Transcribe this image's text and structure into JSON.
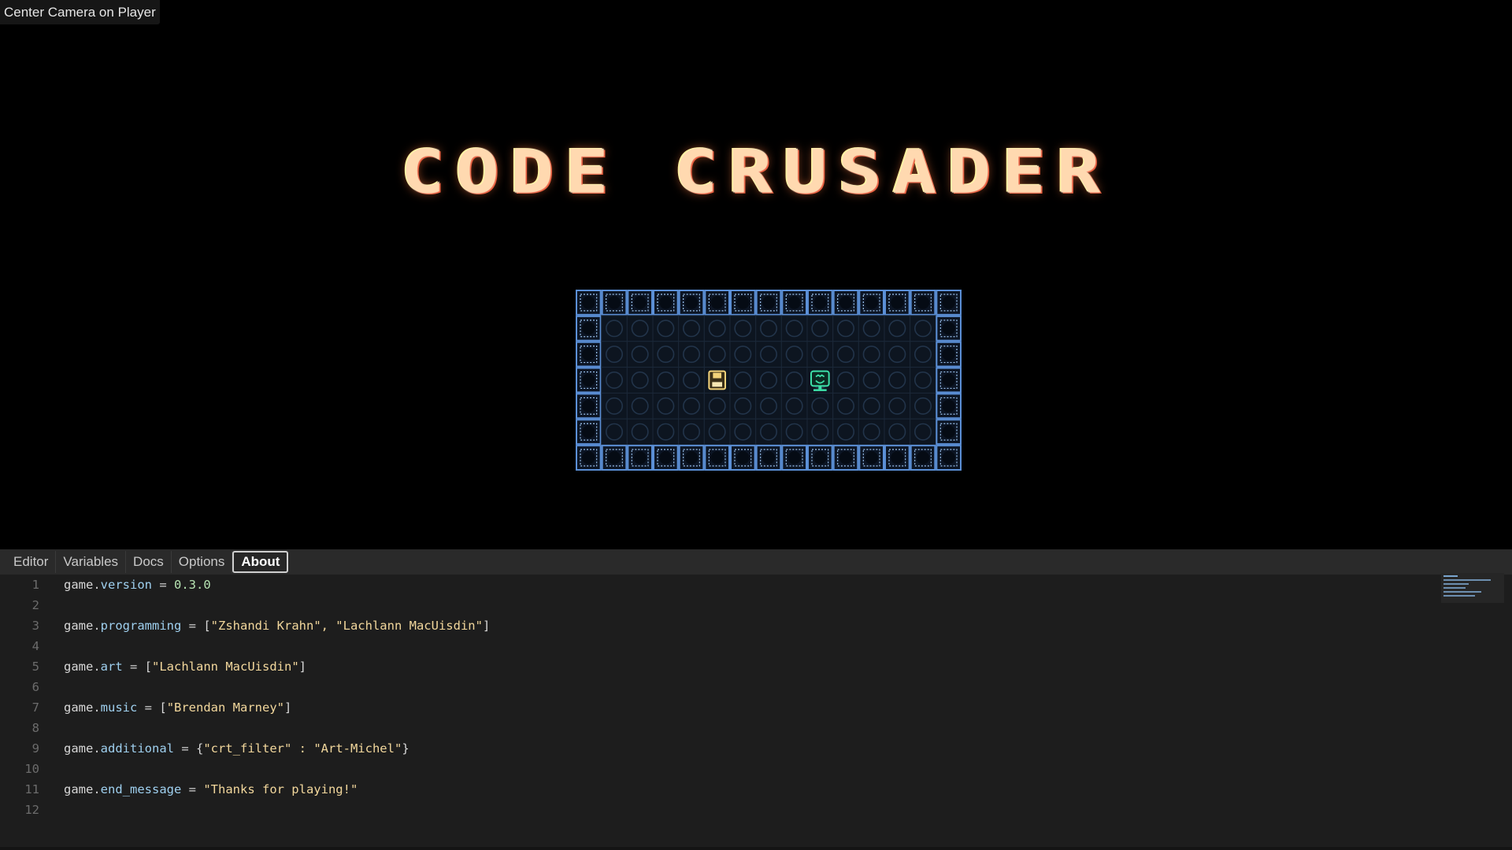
{
  "toolbar": {
    "center_camera_label": "Center Camera on Player"
  },
  "game": {
    "title": "CODE CRUSADER"
  },
  "tabs": [
    {
      "label": "Editor",
      "active": false
    },
    {
      "label": "Variables",
      "active": false
    },
    {
      "label": "Docs",
      "active": false
    },
    {
      "label": "Options",
      "active": false
    },
    {
      "label": "About",
      "active": true
    }
  ],
  "code_lines": [
    {
      "n": "1",
      "obj": "game",
      "prop": "version",
      "eq": " = ",
      "open": "",
      "value": "0.3.0",
      "close": "",
      "kind": "num"
    },
    {
      "n": "2"
    },
    {
      "n": "3",
      "obj": "game",
      "prop": "programming",
      "eq": " = ",
      "open": "[",
      "value": "\"Zshandi Krahn\", \"Lachlann MacUisdin\"",
      "close": "]",
      "kind": "str"
    },
    {
      "n": "4"
    },
    {
      "n": "5",
      "obj": "game",
      "prop": "art",
      "eq": " = ",
      "open": "[",
      "value": "\"Lachlann MacUisdin\"",
      "close": "]",
      "kind": "str"
    },
    {
      "n": "6"
    },
    {
      "n": "7",
      "obj": "game",
      "prop": "music",
      "eq": " = ",
      "open": "[",
      "value": "\"Brendan Marney\"",
      "close": "]",
      "kind": "str"
    },
    {
      "n": "8"
    },
    {
      "n": "9",
      "obj": "game",
      "prop": "additional",
      "eq": " = ",
      "open": "{",
      "value": "\"crt_filter\" : \"Art-Michel\"",
      "close": "}",
      "kind": "str"
    },
    {
      "n": "10"
    },
    {
      "n": "11",
      "obj": "game",
      "prop": "end_message",
      "eq": " = ",
      "open": "",
      "value": "\"Thanks for playing!\"",
      "close": "",
      "kind": "str"
    },
    {
      "n": "12"
    }
  ],
  "level": {
    "cols": 15,
    "rows": 7,
    "wall_color": "#5b8fd6",
    "floor_color": "#1d2a38",
    "sprites": [
      {
        "name": "floppy-disk-icon",
        "col": 5,
        "row": 3,
        "color": "#f2d27a"
      },
      {
        "name": "player-robot-icon",
        "col": 9,
        "row": 3,
        "color": "#3de0a8"
      }
    ]
  },
  "colors": {
    "editor_bg": "#1e1e1e",
    "tab_bar_bg": "#2a2a2a",
    "title_color": "#ffd9b0"
  }
}
